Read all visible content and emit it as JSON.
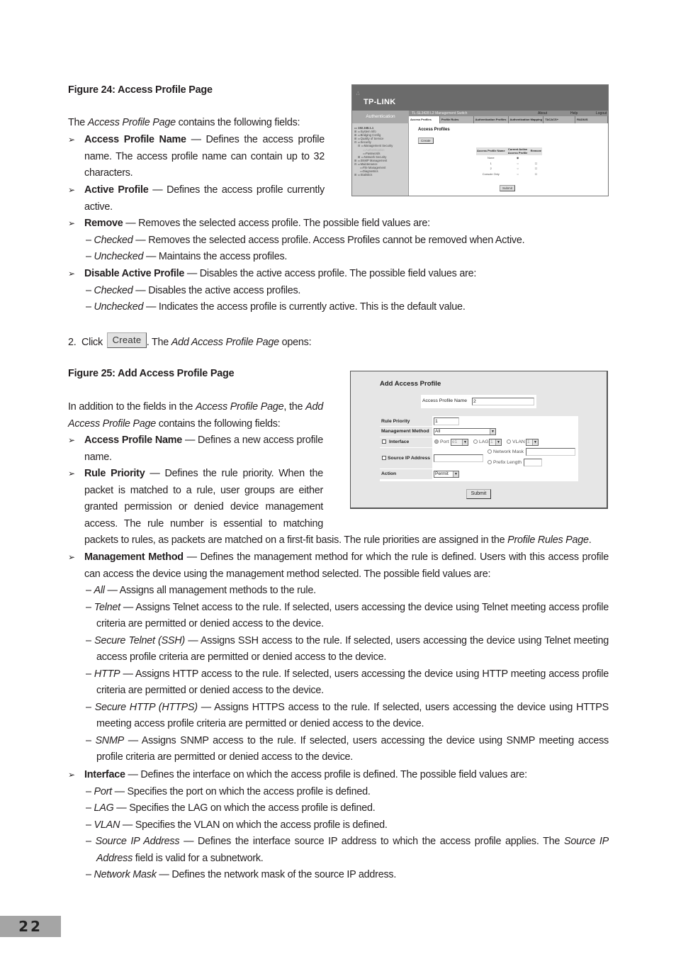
{
  "figure24": {
    "caption": "Figure 24: Access Profile Page",
    "screenshot": {
      "brand": "TP-LINK",
      "section": "Authentication",
      "device_title": "TL-SL3428 L2 Management Switch",
      "links": [
        "About",
        "Help",
        "Logout"
      ],
      "tabs": [
        "Access Profiles",
        "Profile Rules",
        "Authentication Profiles",
        "Authentication Mapping",
        "TACACS+",
        "RADIUS"
      ],
      "tree": [
        "192.168.1.1",
        "System Info",
        "Bridging Config",
        "Quality of Service",
        "Security",
        "Management Security",
        "Authentication",
        "Passwords",
        "Network Security",
        "SNMP Management",
        "Maintenance",
        "File Management",
        "Diagnostics",
        "Statistics"
      ],
      "content_title": "Access Profiles",
      "create_button": "Create",
      "table": {
        "headers": [
          "Access Profile Name",
          "Current Active Access Profile",
          "Remove"
        ],
        "rows": [
          {
            "name": "None",
            "active": true,
            "removable": false
          },
          {
            "name": "1",
            "active": false,
            "removable": true
          },
          {
            "name": "2",
            "active": false,
            "removable": true
          },
          {
            "name": "Console Only",
            "active": false,
            "removable": true
          }
        ]
      },
      "submit_button": "Submit"
    }
  },
  "intro24": {
    "pre": "The ",
    "italic": "Access Profile Page",
    "post": " contains the following fields:"
  },
  "fields24": [
    {
      "term": "Access Profile Name",
      "desc": " — Defines the access profile name. The access profile name can contain up to 32 characters."
    },
    {
      "term": "Active Profile",
      "desc": " — Defines the access profile currently active."
    },
    {
      "term": "Remove",
      "desc": " — Removes the selected access profile. The possible field values are:",
      "values": [
        {
          "term": "Checked",
          "desc": " — Removes the selected access profile. Access Profiles cannot be removed when Active."
        },
        {
          "term": "Unchecked",
          "desc": " — Maintains the access profiles."
        }
      ]
    },
    {
      "term": "Disable Active Profile",
      "desc": " — Disables the active access profile. The possible field values are:",
      "values": [
        {
          "term": "Checked",
          "desc": " — Disables the active access profiles."
        },
        {
          "term": "Unchecked",
          "desc": " — Indicates the access profile is currently active. This is the default value."
        }
      ]
    }
  ],
  "step2": {
    "num": "2.",
    "click": "Click",
    "button": "Create",
    "pre": ". The ",
    "italic": "Add Access Profile Page",
    "post": " opens:"
  },
  "figure25": {
    "caption": "Figure 25: Add Access Profile Page",
    "screenshot": {
      "title": "Add Access Profile",
      "profile_name_label": "Access Profile Name",
      "profile_name_value": "2",
      "rule_priority_label": "Rule Priority",
      "rule_priority_value": "1",
      "management_method_label": "Management Method",
      "management_method_value": "All",
      "interface_label": "Interface",
      "port_label": "Port",
      "port_value": "e1",
      "lag_label": "LAG",
      "lag_value": "1",
      "vlan_label": "VLAN",
      "vlan_value": "1",
      "source_ip_label": "Source IP Address",
      "network_mask_label": "Network Mask",
      "prefix_length_label": "Prefix Length",
      "action_label": "Action",
      "action_value": "Permit",
      "submit_button": "Submit"
    }
  },
  "intro25": {
    "pre": "In addition to the fields in the ",
    "italic1": "Access Profile Page",
    "mid": ", the ",
    "italic2": "Add Access Profile Page",
    "post": " contains the following fields:"
  },
  "fields25": {
    "apn": {
      "term": "Access Profile Name",
      "desc": " — Defines a new access profile name."
    },
    "rule": {
      "term": "Rule Priority",
      "desc": " — Defines the rule priority. When the packet is matched to a rule, user groups are either granted permission or denied device management access. The rule number is essential to matching",
      "cont": "packets to rules, as packets are matched on a first-fit basis. The rule priorities are assigned in the ",
      "cont_italic": "Profile Rules Page",
      "cont_end": "."
    },
    "mm": {
      "term": "Management Method",
      "desc": " — Defines the management method for which the rule is defined. Users with this access profile can access the device using the management method selected. The possible field values are:",
      "values": [
        {
          "term": "All",
          "desc": " — Assigns all management methods to the rule."
        },
        {
          "term": "Telnet",
          "desc": " — Assigns Telnet access to the rule. If selected, users accessing the device using Telnet meeting access profile criteria are permitted or denied access to the device."
        },
        {
          "term": "Secure Telnet (SSH)",
          "desc": " — Assigns SSH access to the rule. If selected, users accessing the device using Telnet meeting access profile criteria are permitted or denied access to the device."
        },
        {
          "term": "HTTP",
          "desc": " — Assigns HTTP access to the rule. If selected, users accessing the device using HTTP meeting access profile criteria are permitted or denied access to the device."
        },
        {
          "term": "Secure HTTP (HTTPS)",
          "desc": " — Assigns HTTPS access to the rule. If selected, users accessing the device using HTTPS meeting access profile criteria are permitted or denied access to the device."
        },
        {
          "term": "SNMP",
          "desc": " — Assigns SNMP access to the rule. If selected, users accessing the device using SNMP meeting access profile criteria are permitted or denied access to the device."
        }
      ]
    },
    "iface": {
      "term": "Interface",
      "desc": " — Defines the interface on which the access profile is defined. The possible field values are:",
      "values": [
        {
          "term": "Port",
          "desc": " — Specifies the port on which the access profile is defined."
        },
        {
          "term": "LAG",
          "desc": " — Specifies the LAG on which the access profile is defined."
        },
        {
          "term": "VLAN",
          "desc": " — Specifies the VLAN on which the access profile is defined."
        },
        {
          "term": "Source IP Address",
          "desc": " — Defines the interface source IP address to which the access profile applies. The ",
          "italic2": "Source IP Address",
          "desc2": " field is valid for a subnetwork."
        },
        {
          "term": "Network Mask",
          "desc": " — Defines the network mask of the source IP address."
        }
      ]
    }
  },
  "page_number": "22"
}
